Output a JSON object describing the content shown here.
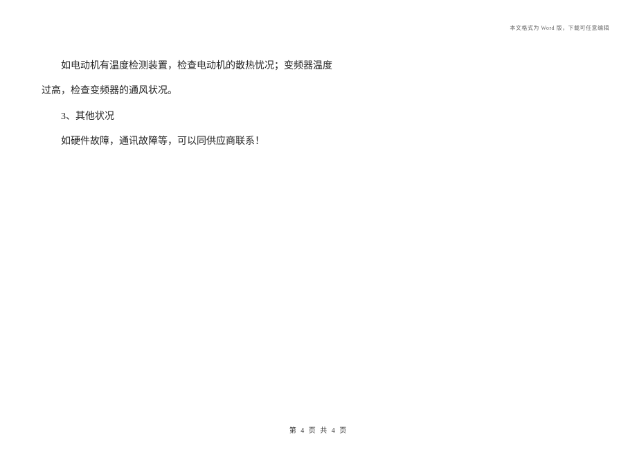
{
  "header": {
    "note": "本文格式为 Word 版，下载可任意编辑"
  },
  "content": {
    "paragraphs": [
      {
        "text": "如电动机有温度检测装置，检查电动机的散热忧况；变频器温度",
        "indent": true
      },
      {
        "text": "过高，检查变频器的通风状况。",
        "indent": false
      },
      {
        "text": "3、其他状况",
        "indent": true
      },
      {
        "text": "如硬件故障，通讯故障等，可以同供应商联系！",
        "indent": true
      }
    ]
  },
  "footer": {
    "page_label": "第 4 页 共 4 页"
  }
}
